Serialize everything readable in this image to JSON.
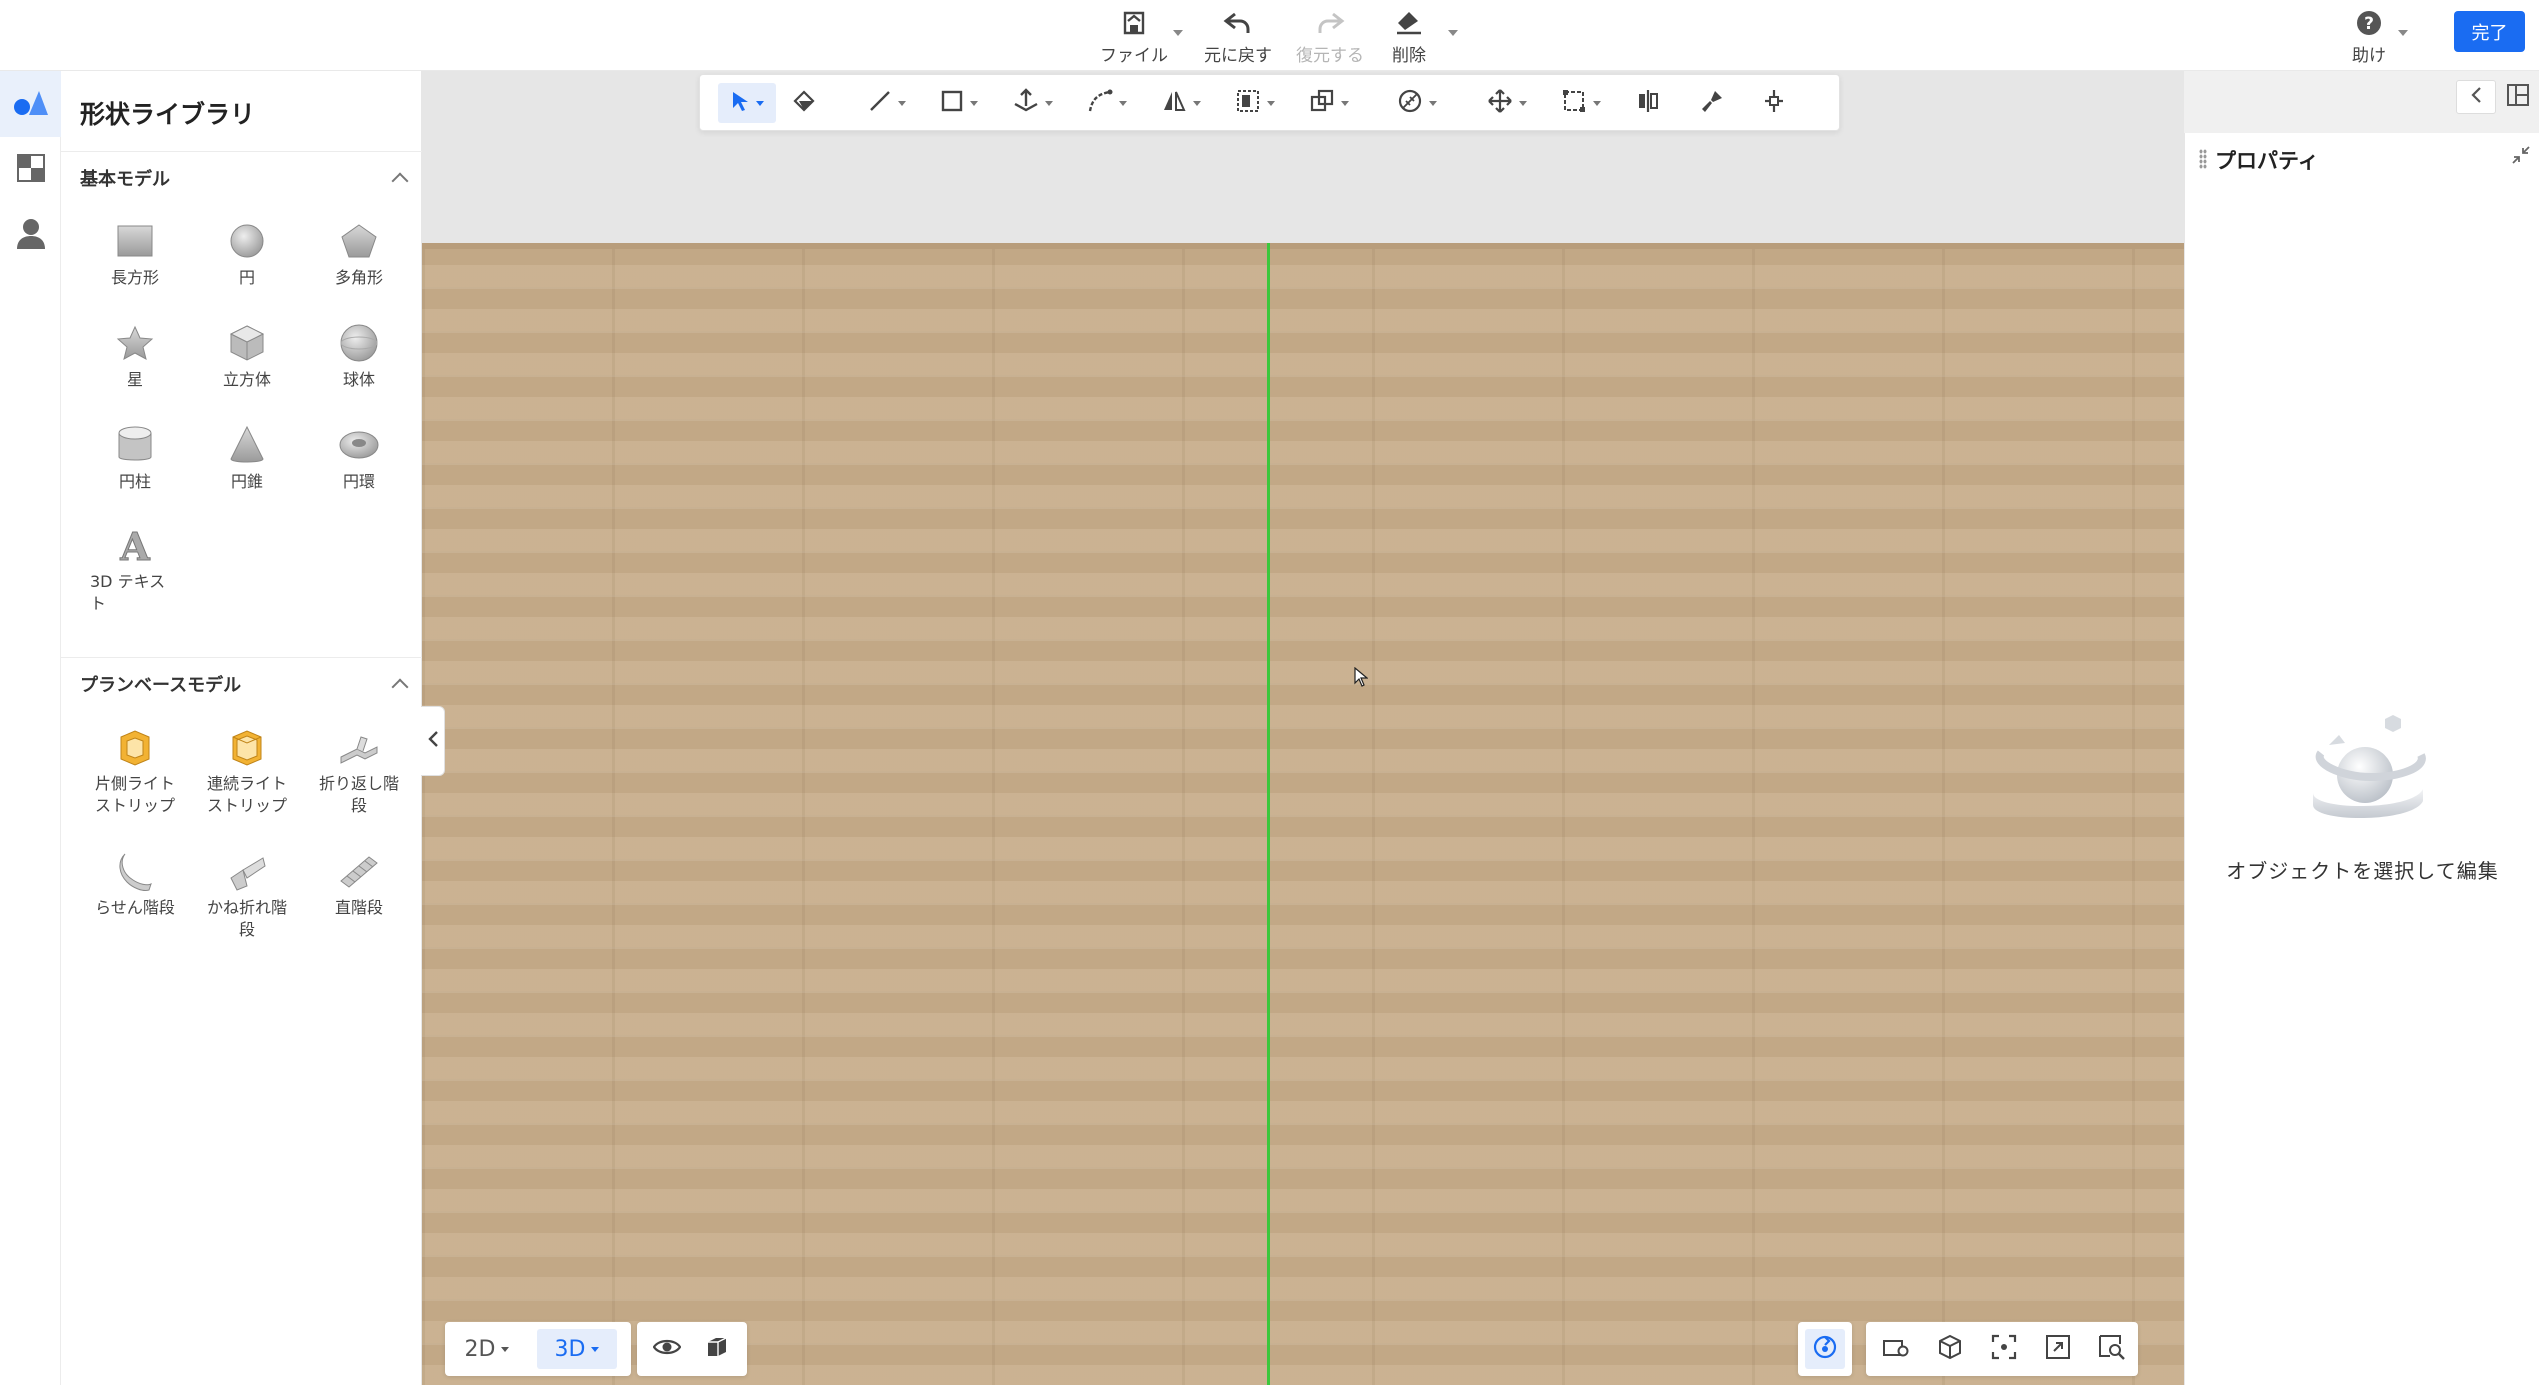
{
  "topbar": {
    "file_label": "ファイル",
    "undo_label": "元に戻す",
    "redo_label": "復元する",
    "delete_label": "削除",
    "help_label": "助け",
    "done_label": "完了"
  },
  "library": {
    "title": "形状ライブラリ",
    "basic_section": {
      "title": "基本モデル",
      "items": [
        {
          "label": "長方形",
          "icon": "rectangle-icon"
        },
        {
          "label": "円",
          "icon": "circle-icon"
        },
        {
          "label": "多角形",
          "icon": "polygon-icon"
        },
        {
          "label": "星",
          "icon": "star-icon"
        },
        {
          "label": "立方体",
          "icon": "cube-icon"
        },
        {
          "label": "球体",
          "icon": "sphere-icon"
        },
        {
          "label": "円柱",
          "icon": "cylinder-icon"
        },
        {
          "label": "円錐",
          "icon": "cone-icon"
        },
        {
          "label": "円環",
          "icon": "torus-icon"
        },
        {
          "label": "3D テキスト",
          "icon": "3d-text-icon"
        }
      ]
    },
    "plan_section": {
      "title": "プランベースモデル",
      "items": [
        {
          "label": "片側ライトストリップ",
          "icon": "single-light-strip-icon"
        },
        {
          "label": "連続ライトストリップ",
          "icon": "continuous-light-strip-icon"
        },
        {
          "label": "折り返し階段",
          "icon": "switchback-stairs-icon"
        },
        {
          "label": "らせん階段",
          "icon": "spiral-stairs-icon"
        },
        {
          "label": "かね折れ階段",
          "icon": "l-shaped-stairs-icon"
        },
        {
          "label": "直階段",
          "icon": "straight-stairs-icon"
        }
      ]
    }
  },
  "view": {
    "mode_2d": "2D",
    "mode_3d": "3D",
    "active_mode": "3D"
  },
  "properties": {
    "title": "プロパティ",
    "empty_message": "オブジェクトを選択して編集"
  },
  "colors": {
    "accent": "#1a6cf2",
    "axis_green": "#3cc73c",
    "floor": "#c9b08f"
  }
}
